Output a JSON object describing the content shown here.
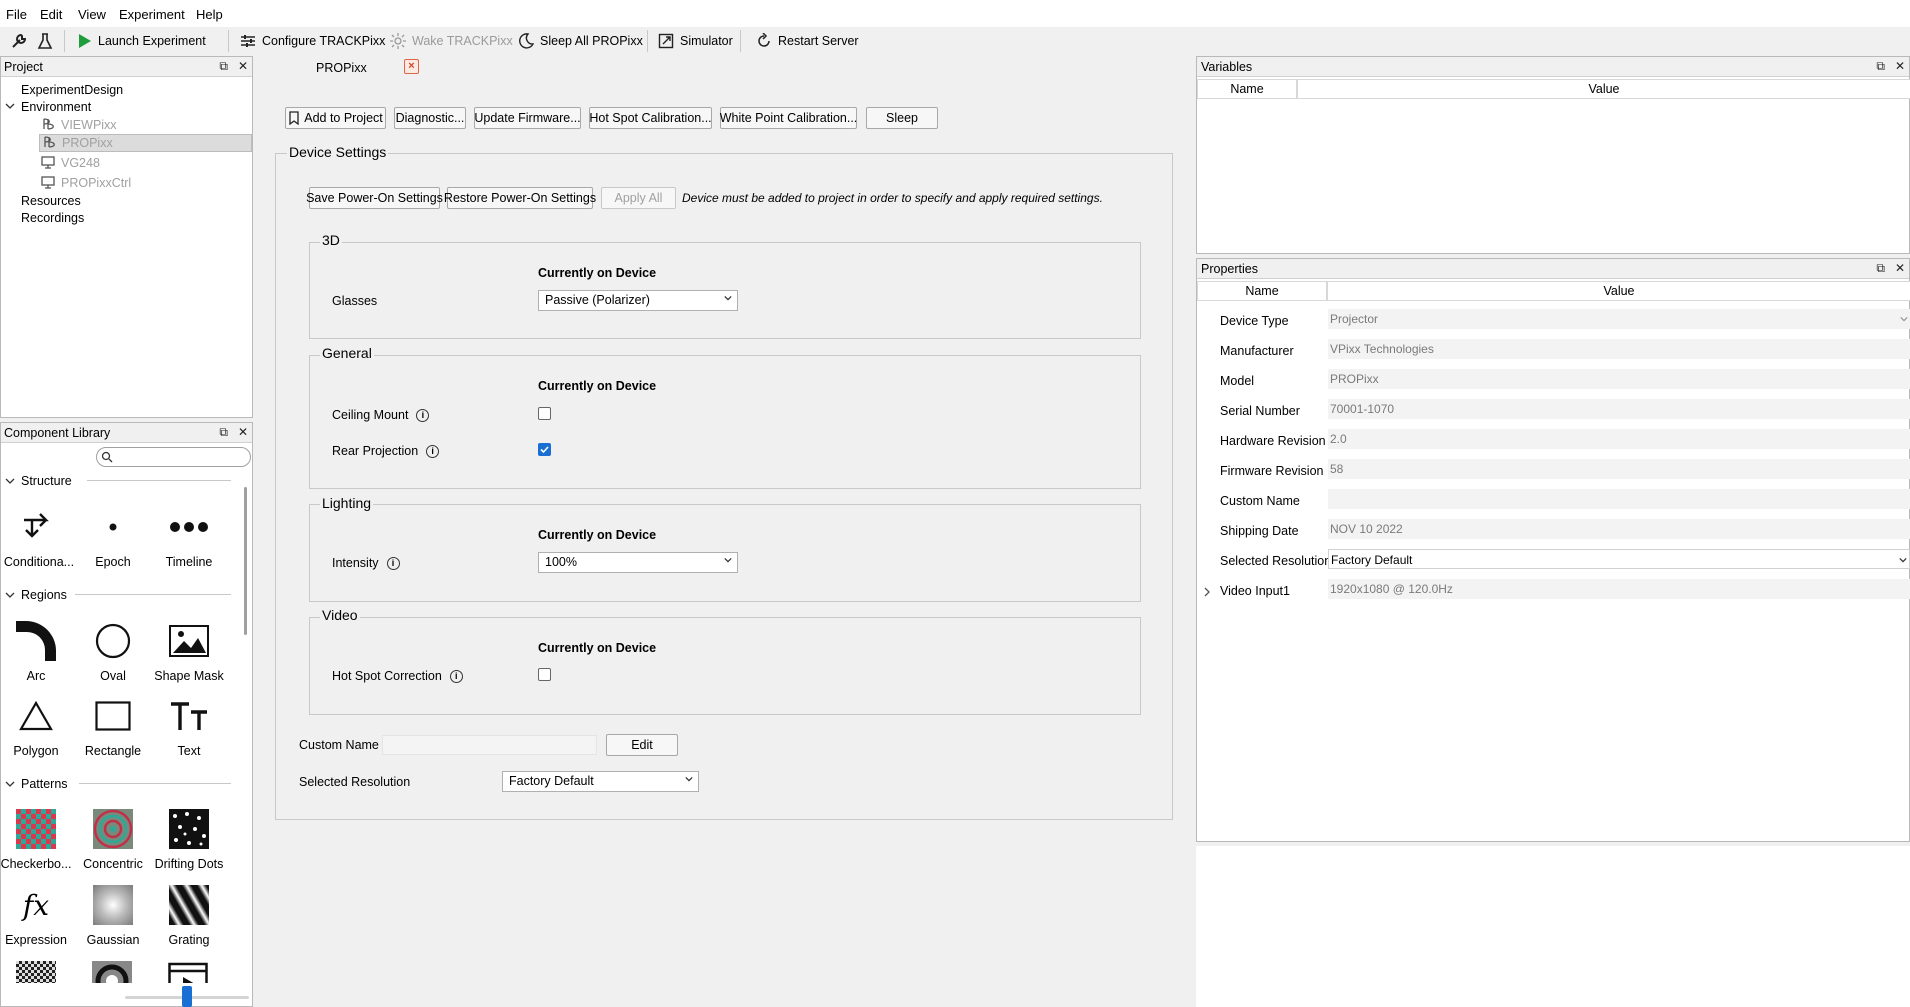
{
  "menu": [
    "File",
    "Edit",
    "View",
    "Experiment",
    "Help"
  ],
  "toolbar": {
    "launch_label": "Launch Experiment",
    "configure_label": "Configure TRACKPixx",
    "wake_label": "Wake TRACKPixx",
    "sleep_all_label": "Sleep All PROPixx",
    "simulator_label": "Simulator",
    "restart_label": "Restart Server"
  },
  "project": {
    "title": "Project",
    "items": [
      {
        "label": "ExperimentDesign"
      },
      {
        "label": "Environment"
      },
      {
        "label": "VIEWPixx"
      },
      {
        "label": "PROPixx"
      },
      {
        "label": "VG248"
      },
      {
        "label": "PROPixxCtrl"
      },
      {
        "label": "Resources"
      },
      {
        "label": "Recordings"
      }
    ]
  },
  "library": {
    "title": "Component Library",
    "search_value": "",
    "sections": {
      "structure": "Structure",
      "regions": "Regions",
      "patterns": "Patterns"
    },
    "structure_items": [
      "Conditiona...",
      "Epoch",
      "Timeline"
    ],
    "region_items": [
      "Arc",
      "Oval",
      "Shape Mask",
      "Polygon",
      "Rectangle",
      "Text"
    ],
    "pattern_items": [
      "Checkerbo...",
      "Concentric",
      "Drifting Dots",
      "Expression",
      "Gaussian",
      "Grating"
    ]
  },
  "tab": {
    "title": "PROPixx"
  },
  "actions": {
    "add_to_project": "Add to Project",
    "diagnostic": "Diagnostic...",
    "update_firmware": "Update Firmware...",
    "hot_spot_calibration": "Hot Spot Calibration...",
    "white_point_calibration": "White Point Calibration...",
    "sleep": "Sleep"
  },
  "device_settings": {
    "title": "Device Settings",
    "save_power_on": "Save Power-On Settings",
    "restore_power_on": "Restore Power-On Settings",
    "apply_all": "Apply All",
    "notice": "Device must be added to project in order to specify and apply required settings.",
    "currently_on_device": "Currently on Device",
    "groups": {
      "three_d": {
        "title": "3D",
        "glasses_label": "Glasses",
        "glasses_value": "Passive (Polarizer)"
      },
      "general": {
        "title": "General",
        "ceiling_mount_label": "Ceiling Mount",
        "ceiling_mount_checked": false,
        "rear_projection_label": "Rear Projection",
        "rear_projection_checked": true
      },
      "lighting": {
        "title": "Lighting",
        "intensity_label": "Intensity",
        "intensity_value": "100%"
      },
      "video": {
        "title": "Video",
        "hot_spot_label": "Hot Spot Correction",
        "hot_spot_checked": false
      }
    },
    "custom_name_label": "Custom Name",
    "custom_name_value": "",
    "edit_button": "Edit",
    "selected_resolution_label": "Selected Resolution",
    "selected_resolution_value": "Factory Default"
  },
  "variables": {
    "title": "Variables",
    "col_name": "Name",
    "col_value": "Value"
  },
  "properties": {
    "title": "Properties",
    "col_name": "Name",
    "col_value": "Value",
    "rows": [
      {
        "name": "Device Type",
        "value": "Projector"
      },
      {
        "name": "Manufacturer",
        "value": "VPixx Technologies"
      },
      {
        "name": "Model",
        "value": "PROPixx"
      },
      {
        "name": "Serial Number",
        "value": "70001-1070"
      },
      {
        "name": "Hardware Revision",
        "value": "2.0"
      },
      {
        "name": "Firmware Revision",
        "value": "58"
      },
      {
        "name": "Custom Name",
        "value": ""
      },
      {
        "name": "Shipping Date",
        "value": "NOV 10 2022"
      },
      {
        "name": "Selected Resolution",
        "value": "Factory Default"
      },
      {
        "name": "Video Input1",
        "value": "1920x1080 @ 120.0Hz"
      }
    ]
  }
}
